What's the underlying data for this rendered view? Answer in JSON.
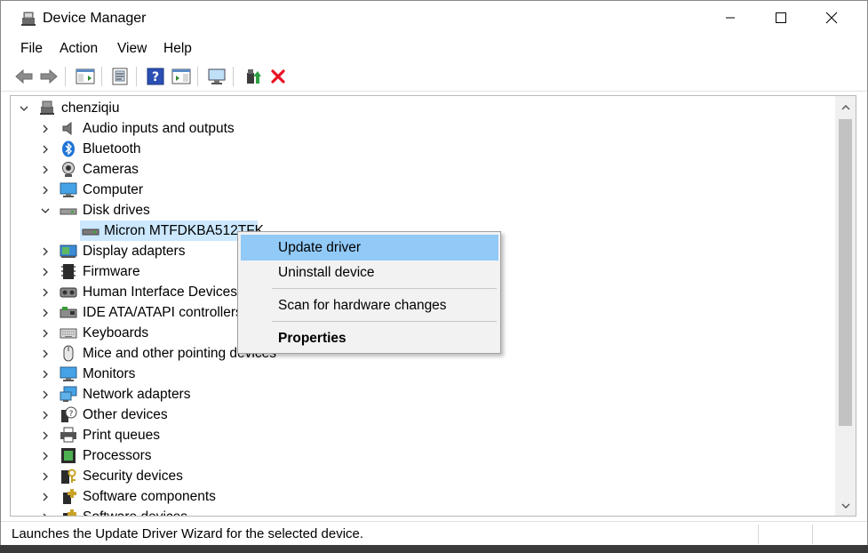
{
  "window": {
    "title": "Device Manager",
    "minimize_symbol": "—",
    "close_symbol": "✕"
  },
  "menu": {
    "items": [
      "File",
      "Action",
      "View",
      "Help"
    ]
  },
  "toolbar": {
    "icons": [
      "back-icon",
      "forward-icon",
      "show-hide-console-tree-icon",
      "properties-icon",
      "help-icon",
      "action-pane-icon",
      "monitor-icon",
      "update-driver-icon",
      "uninstall-icon"
    ]
  },
  "tree": {
    "root": "chenziqiu",
    "categories": [
      {
        "label": "Audio inputs and outputs",
        "icon": "speaker-icon"
      },
      {
        "label": "Bluetooth",
        "icon": "bluetooth-icon"
      },
      {
        "label": "Cameras",
        "icon": "camera-icon"
      },
      {
        "label": "Computer",
        "icon": "computer-icon"
      },
      {
        "label": "Disk drives",
        "icon": "disk-drive-icon"
      },
      {
        "label": "Micron MTFDKBA512TFK",
        "icon": "disk-drive-icon"
      },
      {
        "label": "Display adapters",
        "icon": "display-adapter-icon"
      },
      {
        "label": "Firmware",
        "icon": "firmware-icon"
      },
      {
        "label": "Human Interface Devices",
        "icon": "hid-icon"
      },
      {
        "label": "IDE ATA/ATAPI controllers",
        "icon": "ide-icon"
      },
      {
        "label": "Keyboards",
        "icon": "keyboard-icon"
      },
      {
        "label": "Mice and other pointing devices",
        "icon": "mouse-icon"
      },
      {
        "label": "Monitors",
        "icon": "monitor-icon"
      },
      {
        "label": "Network adapters",
        "icon": "network-adapter-icon"
      },
      {
        "label": "Other devices",
        "icon": "other-devices-icon"
      },
      {
        "label": "Print queues",
        "icon": "printer-icon"
      },
      {
        "label": "Processors",
        "icon": "processor-icon"
      },
      {
        "label": "Security devices",
        "icon": "security-device-icon"
      },
      {
        "label": "Software components",
        "icon": "software-component-icon"
      },
      {
        "label": "Software devices",
        "icon": "software-device-icon"
      }
    ]
  },
  "context_menu": {
    "update_driver": "Update driver",
    "uninstall_device": "Uninstall device",
    "scan_hardware": "Scan for hardware changes",
    "properties": "Properties"
  },
  "status": {
    "text": "Launches the Update Driver Wizard for the selected device."
  },
  "colors": {
    "selection": "#cce8ff",
    "menu_highlight": "#91c9f7",
    "delete_red": "#e81123"
  }
}
